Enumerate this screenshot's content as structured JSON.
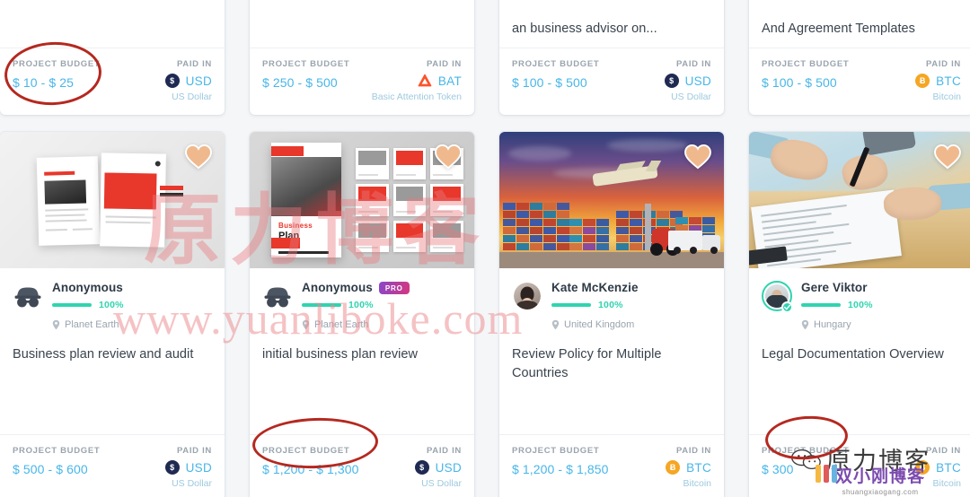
{
  "labels": {
    "project_budget": "PROJECT BUDGET",
    "paid_in": "PAID IN",
    "pro_badge": "PRO"
  },
  "top_row": [
    {
      "title_fragment": "",
      "budget": "$ 10 - $ 25",
      "coin_code": "USD",
      "coin_symbol": "$",
      "currency_name": "US Dollar",
      "coin_type": "usd",
      "annotated": true
    },
    {
      "title_fragment": "",
      "budget": "$ 250 - $ 500",
      "coin_code": "BAT",
      "coin_symbol": "",
      "currency_name": "Basic Attention Token",
      "coin_type": "bat",
      "annotated": false
    },
    {
      "title_fragment": "an business advisor on...",
      "budget": "$ 100 - $ 500",
      "coin_code": "USD",
      "coin_symbol": "$",
      "currency_name": "US Dollar",
      "coin_type": "usd",
      "annotated": false
    },
    {
      "title_fragment": "And Agreement Templates",
      "budget": "$ 100 - $ 500",
      "coin_code": "BTC",
      "coin_symbol": "Ƀ",
      "currency_name": "Bitcoin",
      "coin_type": "btc",
      "annotated": false
    }
  ],
  "bottom_row": [
    {
      "thumbnail": "brochure-mockup-image",
      "favorite_icon": "heart-icon",
      "avatar_icon": "incognito-avatar-icon",
      "avatar_type": "incognito",
      "user_name": "Anonymous",
      "is_pro": false,
      "verified": false,
      "rating": "100%",
      "location": "Planet Earth",
      "title": "Business plan review and audit",
      "budget": "$ 500 - $ 600",
      "coin_code": "USD",
      "coin_symbol": "$",
      "currency_name": "US Dollar",
      "coin_type": "usd",
      "annotated": false
    },
    {
      "thumbnail": "business-plan-deck-image",
      "favorite_icon": "heart-icon",
      "avatar_icon": "incognito-avatar-icon",
      "avatar_type": "incognito",
      "user_name": "Anonymous",
      "is_pro": true,
      "verified": false,
      "rating": "100%",
      "location": "Planet Earth",
      "title": "initial business plan review",
      "budget": "$ 1,200 - $ 1,300",
      "coin_code": "USD",
      "coin_symbol": "$",
      "currency_name": "US Dollar",
      "coin_type": "usd",
      "annotated": true
    },
    {
      "thumbnail": "shipping-containers-sunset-image",
      "favorite_icon": "heart-icon",
      "avatar_icon": "user-photo-avatar",
      "avatar_type": "photo",
      "user_name": "Kate McKenzie",
      "is_pro": false,
      "verified": false,
      "rating": "100%",
      "location": "United Kingdom",
      "title": "Review Policy for Multiple Countries",
      "budget": "$ 1,200 - $ 1,850",
      "coin_code": "BTC",
      "coin_symbol": "Ƀ",
      "currency_name": "Bitcoin",
      "coin_type": "btc",
      "annotated": false
    },
    {
      "thumbnail": "contract-signing-image",
      "favorite_icon": "heart-icon",
      "avatar_icon": "user-photo-avatar",
      "avatar_type": "photo",
      "user_name": "Gere Viktor",
      "is_pro": false,
      "verified": true,
      "rating": "100%",
      "location": "Hungary",
      "title": "Legal Documentation Overview",
      "budget": "$ 300",
      "coin_code": "BTC",
      "coin_symbol": "Ƀ",
      "currency_name": "Bitcoin",
      "coin_type": "btc",
      "annotated": true
    }
  ],
  "watermarks": {
    "chinese_big": "原力博客",
    "url": "www.yuanliboke.com",
    "wechat_text": "原力博客",
    "sxg_text": "双小刚博客",
    "sxg_url": "shuangxiaogang.com"
  },
  "colors": {
    "accent_blue": "#47b6e8",
    "rating_teal": "#2fd4b0",
    "annotation_red": "#b5281f",
    "usd_coin": "#1f2a52",
    "btc_coin": "#f5a623",
    "bat_coin": "#fb542b"
  }
}
